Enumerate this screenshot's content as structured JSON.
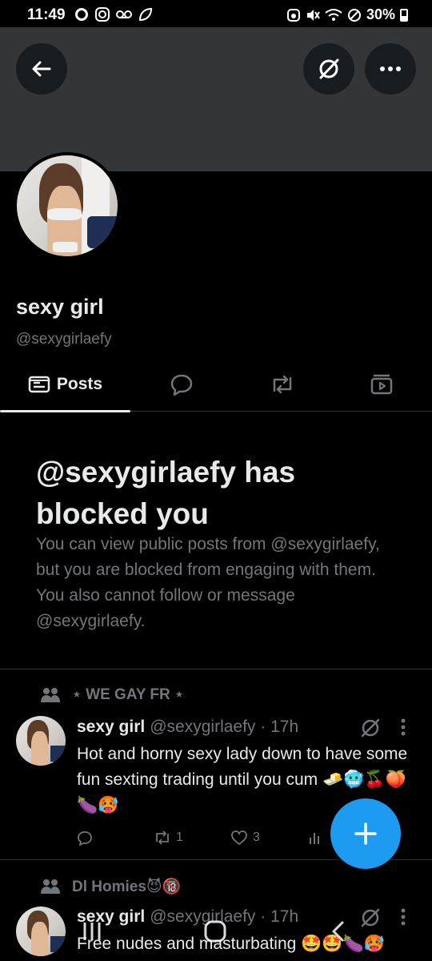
{
  "status_bar": {
    "time": "11:49",
    "battery": "30%",
    "left_icons": [
      "whatsapp-icon",
      "instagram-icon",
      "voicemail-icon",
      "leaf-icon"
    ],
    "right_icons": [
      "alarm-icon",
      "mute-icon",
      "wifi-icon",
      "no-disturb-icon",
      "battery-icon"
    ]
  },
  "profile": {
    "display_name": "sexy girl",
    "handle": "@sexygirlaefy"
  },
  "tabs": [
    {
      "label": "Posts",
      "icon": "posts-icon",
      "active": true
    },
    {
      "label": "",
      "icon": "replies-icon",
      "active": false
    },
    {
      "label": "",
      "icon": "reposts-icon",
      "active": false
    },
    {
      "label": "",
      "icon": "media-icon",
      "active": false
    }
  ],
  "blocked": {
    "title": "@sexygirlaefy has blocked you",
    "description": "You can view public posts from @sexygirlaefy, but you are blocked from engaging with them. You also cannot follow or message @sexygirlaefy."
  },
  "posts": [
    {
      "context": "⋆ WE GAY FR ⋆",
      "name": "sexy girl",
      "meta": "@sexygirlaefy · 17h",
      "text": "Hot and horny sexy lady down to have some fun sexting trading until you cum 🧈🥶🍒🍑🍆🥵",
      "reposts": "1",
      "likes": "3"
    },
    {
      "context": "Dl Homies😈🔞",
      "name": "sexy girl",
      "meta": "@sexygirlaefy · 17h",
      "text": "Free nudes and masturbating 🤩🤩🍆🥵"
    }
  ],
  "colors": {
    "accent": "#1d9bf0",
    "muted": "#71767b",
    "text": "#e7e9ea",
    "banner": "#333639",
    "divider": "#2f3336"
  }
}
